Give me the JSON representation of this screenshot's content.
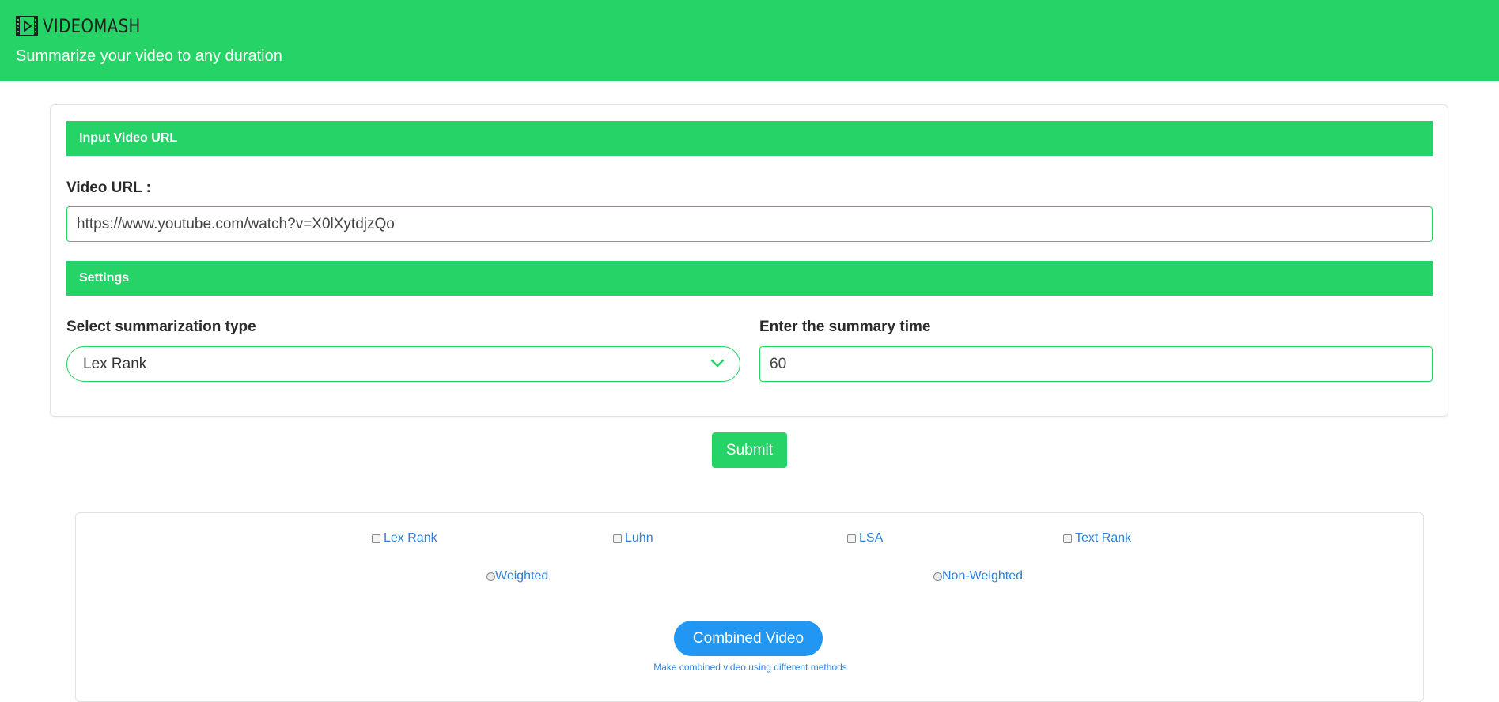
{
  "header": {
    "brand": "VIDEOMASH",
    "tagline": "Summarize your video to any duration",
    "background_color": "#26d367",
    "logo_icon": "film-play-icon"
  },
  "input_section": {
    "title": "Input Video URL",
    "url_label": "Video URL :",
    "url_value": "https://www.youtube.com/watch?v=X0lXytdjzQo"
  },
  "settings_section": {
    "title": "Settings",
    "type_label": "Select summarization type",
    "type_selected": "Lex Rank",
    "time_label": "Enter the summary time",
    "time_value": "60"
  },
  "submit": {
    "label": "Submit"
  },
  "combine_panel": {
    "methods": [
      {
        "label": "Lex Rank",
        "checked": false
      },
      {
        "label": "Luhn",
        "checked": false
      },
      {
        "label": "LSA",
        "checked": false
      },
      {
        "label": "Text Rank",
        "checked": false
      }
    ],
    "weighting": [
      {
        "label": "Weighted",
        "selected": false
      },
      {
        "label": "Non-Weighted",
        "selected": false
      }
    ],
    "combined_button": "Combined Video",
    "combined_hint": "Make combined video using different methods",
    "button_color": "#2196f3"
  }
}
